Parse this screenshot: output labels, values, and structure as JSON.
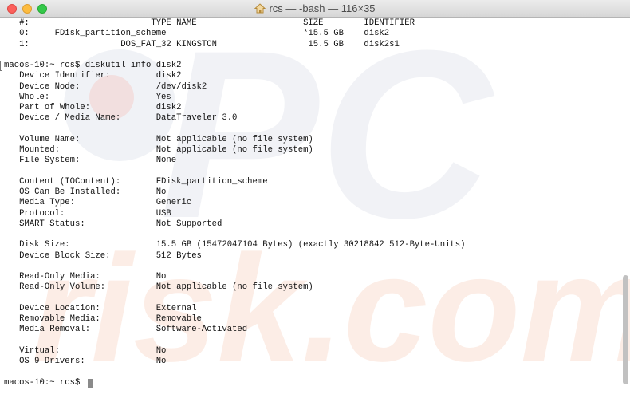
{
  "window": {
    "title": "rcs — -bash — 116×35"
  },
  "partitions": {
    "header": {
      "num": "#:",
      "type": "TYPE",
      "name": "NAME",
      "size": "SIZE",
      "identifier": "IDENTIFIER"
    },
    "rows": [
      {
        "num": "0:",
        "type": "FDisk_partition_scheme",
        "name": "",
        "size": "*15.5 GB",
        "identifier": "disk2"
      },
      {
        "num": "1:",
        "type": "DOS_FAT_32",
        "name": "KINGSTON",
        "size": "15.5 GB",
        "identifier": "disk2s1"
      }
    ]
  },
  "command_prompt": "macos-10:~ rcs$ diskutil info disk2",
  "info_groups": [
    [
      {
        "label": "Device Identifier:",
        "value": "disk2"
      },
      {
        "label": "Device Node:",
        "value": "/dev/disk2"
      },
      {
        "label": "Whole:",
        "value": "Yes"
      },
      {
        "label": "Part of Whole:",
        "value": "disk2"
      },
      {
        "label": "Device / Media Name:",
        "value": "DataTraveler 3.0"
      }
    ],
    [
      {
        "label": "Volume Name:",
        "value": "Not applicable (no file system)"
      },
      {
        "label": "Mounted:",
        "value": "Not applicable (no file system)"
      },
      {
        "label": "File System:",
        "value": "None"
      }
    ],
    [
      {
        "label": "Content (IOContent):",
        "value": "FDisk_partition_scheme"
      },
      {
        "label": "OS Can Be Installed:",
        "value": "No"
      },
      {
        "label": "Media Type:",
        "value": "Generic"
      },
      {
        "label": "Protocol:",
        "value": "USB"
      },
      {
        "label": "SMART Status:",
        "value": "Not Supported"
      }
    ],
    [
      {
        "label": "Disk Size:",
        "value": "15.5 GB (15472047104 Bytes) (exactly 30218842 512-Byte-Units)"
      },
      {
        "label": "Device Block Size:",
        "value": "512 Bytes"
      }
    ],
    [
      {
        "label": "Read-Only Media:",
        "value": "No"
      },
      {
        "label": "Read-Only Volume:",
        "value": "Not applicable (no file system)"
      }
    ],
    [
      {
        "label": "Device Location:",
        "value": "External"
      },
      {
        "label": "Removable Media:",
        "value": "Removable"
      },
      {
        "label": "Media Removal:",
        "value": "Software-Activated"
      }
    ],
    [
      {
        "label": "Virtual:",
        "value": "No"
      },
      {
        "label": "OS 9 Drivers:",
        "value": "No"
      }
    ]
  ],
  "final_prompt": "macos-10:~ rcs$",
  "watermark": "PCrisk.com"
}
